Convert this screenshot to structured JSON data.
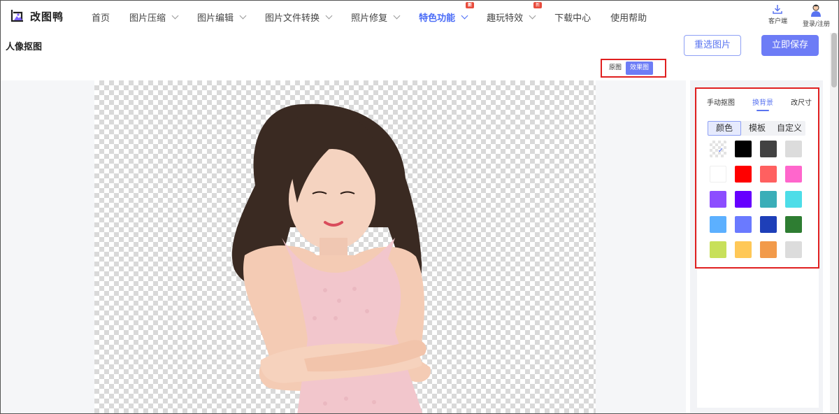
{
  "app": {
    "logo_text": "改图鸭"
  },
  "nav": {
    "items": [
      {
        "label": "首页",
        "dropdown": false,
        "badge": ""
      },
      {
        "label": "图片压缩",
        "dropdown": true,
        "badge": ""
      },
      {
        "label": "图片编辑",
        "dropdown": true,
        "badge": ""
      },
      {
        "label": "图片文件转换",
        "dropdown": true,
        "badge": ""
      },
      {
        "label": "照片修复",
        "dropdown": true,
        "badge": ""
      },
      {
        "label": "特色功能",
        "dropdown": true,
        "badge": "新",
        "active": true
      },
      {
        "label": "趣玩特效",
        "dropdown": true,
        "badge": "新"
      },
      {
        "label": "下载中心",
        "dropdown": false,
        "badge": ""
      },
      {
        "label": "使用帮助",
        "dropdown": false,
        "badge": ""
      }
    ],
    "client_label": "客户端",
    "login_label": "登录/注册"
  },
  "page": {
    "title": "人像抠图"
  },
  "actions": {
    "reselect_label": "重选图片",
    "save_label": "立即保存"
  },
  "view_toggle": {
    "original_label": "原图",
    "result_label": "效果图",
    "selected": "效果图"
  },
  "panel": {
    "tabs": [
      "手动抠图",
      "换背景",
      "改尺寸"
    ],
    "active_tab": "换背景",
    "subtabs": [
      "颜色",
      "模板",
      "自定义"
    ],
    "active_subtab": "颜色",
    "swatches": [
      "transparent",
      "#000000",
      "#424242",
      "#dcdcdc",
      "#ffffff",
      "#ff0000",
      "#ff6060",
      "#ff66cc",
      "#8c4dff",
      "#6600ff",
      "#3aaeb8",
      "#4ddde8",
      "#5cb0ff",
      "#6a7aff",
      "#1e3fb8",
      "#2e7d32",
      "#c8e05a",
      "#ffc857",
      "#f29a4a",
      "#dcdcdc"
    ],
    "selected_swatch": "transparent"
  },
  "colors": {
    "accent": "#5a74f0",
    "primary_button": "#6d7cf6",
    "highlight_box": "#e02020"
  }
}
